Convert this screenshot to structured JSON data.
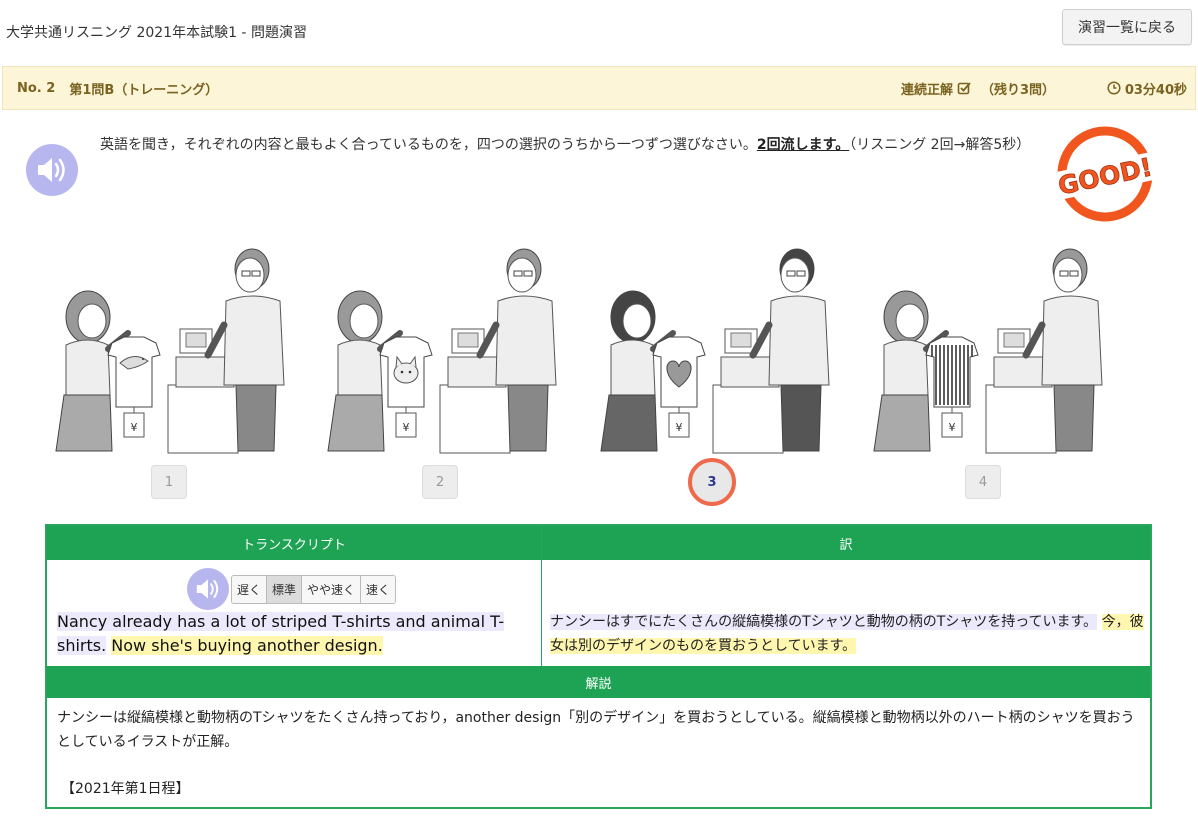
{
  "header": {
    "title": "大学共通リスニング 2021年本試験1 - 問題演習",
    "back_label": "演習一覧に戻る"
  },
  "question_bar": {
    "number": "No. 2",
    "section": "第1問B（トレーニング）",
    "streak_label": "連続正解",
    "remaining": "（残り3問）",
    "timer": "03分40秒"
  },
  "instruction": {
    "text": "英語を聞き，それぞれの内容と最もよく合っているものを，四つの選択のうちから一つずつ選びなさい。",
    "emphasis": "2回流します。",
    "note": "（リスニング 2回→解答5秒）"
  },
  "stamp": {
    "text": "GOOD!"
  },
  "choices": [
    {
      "label": "1",
      "design": "dolphin"
    },
    {
      "label": "2",
      "design": "cat"
    },
    {
      "label": "3",
      "design": "heart"
    },
    {
      "label": "4",
      "design": "stripes"
    }
  ],
  "selected_choice": "3",
  "transcript": {
    "header": "トランスクリプト",
    "speeds": [
      "遅く",
      "標準",
      "やや速く",
      "速く"
    ],
    "active_speed": "標準",
    "sentence1": "Nancy already has a lot of striped T-shirts and animal T-shirts.",
    "sentence2": "Now she's buying another design."
  },
  "translation": {
    "header": "訳",
    "sentence1": "ナンシーはすでにたくさんの縦縞模様のTシャツと動物の柄のTシャツを持っています。",
    "sentence2": "今，彼女は別のデザインのものを買おうとしています。"
  },
  "explanation": {
    "header": "解説",
    "body": "ナンシーは縦縞模様と動物柄のTシャツをたくさん持っており，another design「別のデザイン」を買おうとしている。縦縞模様と動物柄以外のハート柄のシャツを買おうとしているイラストが正解。",
    "date": "【2021年第1日程】"
  },
  "colors": {
    "accent_green": "#1ea354",
    "bar_bg": "#fcf5d8",
    "speaker": "#b8b6ee",
    "stamp": "#f0561e",
    "selected_ring": "#ee6a4d"
  }
}
